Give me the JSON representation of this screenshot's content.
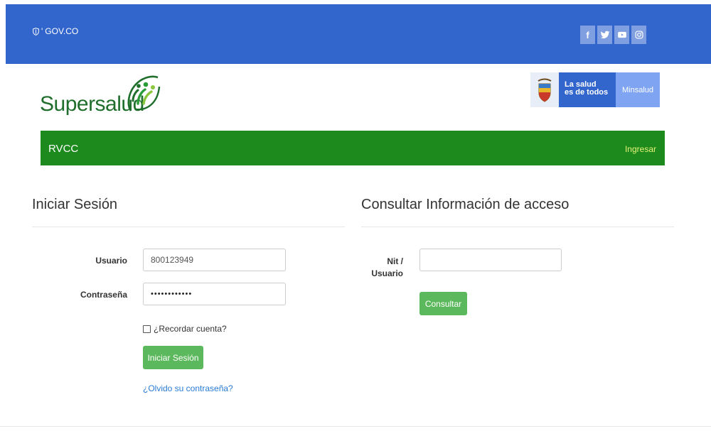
{
  "topbar": {
    "govco_label": "GOV.CO",
    "social": [
      {
        "icon": "facebook-icon",
        "glyph": "f"
      },
      {
        "icon": "twitter-icon"
      },
      {
        "icon": "youtube-icon"
      },
      {
        "icon": "instagram-icon"
      }
    ],
    "color": "#3366cc"
  },
  "header": {
    "logo_text": "Supersalud",
    "badge": {
      "slogan_line1": "La salud",
      "slogan_line2": "es de todos",
      "ministry": "Minsalud"
    }
  },
  "navbar": {
    "brand": "RVCC",
    "ingresar": "Ingresar",
    "color": "#1c8a1c"
  },
  "login": {
    "title": "Iniciar Sesión",
    "usuario_label": "Usuario",
    "usuario_value": "800123949",
    "password_label": "Contraseña",
    "password_value": "••••••••••••",
    "remember_label": "¿Recordar cuenta?",
    "submit_label": "Iniciar Sesión",
    "forgot_link": "¿Olvido su contraseña?"
  },
  "consult": {
    "title": "Consultar Información de acceso",
    "nit_label_line1": "Nit /",
    "nit_label_line2": "Usuario",
    "nit_value": "",
    "submit_label": "Consultar"
  }
}
